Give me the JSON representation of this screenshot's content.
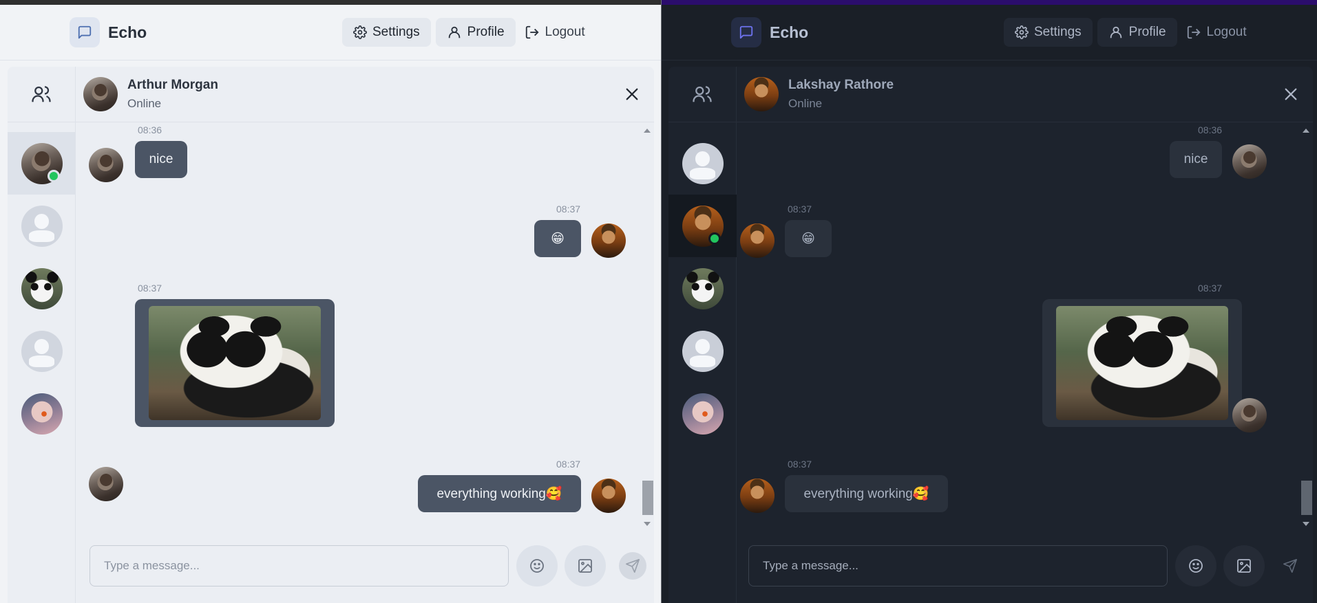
{
  "light": {
    "brand": "Echo",
    "nav": {
      "settings": "Settings",
      "profile": "Profile",
      "logout": "Logout"
    },
    "header": {
      "name": "Arthur Morgan",
      "status": "Online"
    },
    "messages": [
      {
        "time": "08:36",
        "text": "nice"
      },
      {
        "time": "08:37",
        "text": "😁"
      },
      {
        "time": "08:37"
      },
      {
        "time": "08:37",
        "text": "everything working🥰"
      }
    ],
    "composer": {
      "placeholder": "Type a message..."
    }
  },
  "dark": {
    "brand": "Echo",
    "nav": {
      "settings": "Settings",
      "profile": "Profile",
      "logout": "Logout"
    },
    "header": {
      "name": "Lakshay Rathore",
      "status": "Online"
    },
    "messages": [
      {
        "time": "08:36",
        "text": "nice"
      },
      {
        "time": "08:37",
        "text": "😁"
      },
      {
        "time": "08:37"
      },
      {
        "time": "08:37",
        "text": "everything working🥰"
      }
    ],
    "composer": {
      "placeholder": "Type a message..."
    }
  },
  "colors": {
    "online": "#22c55e",
    "light_accent": "#4b5565",
    "dark_accent": "#6366f1"
  },
  "icons": [
    "message-square-icon",
    "gear-icon",
    "user-icon",
    "logout-icon",
    "users-icon",
    "close-icon",
    "emoji-icon",
    "image-icon",
    "send-icon"
  ]
}
